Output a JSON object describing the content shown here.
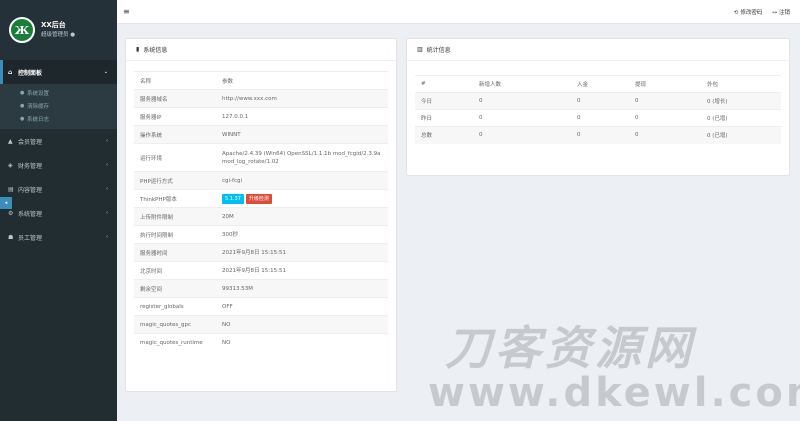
{
  "app": {
    "title": "XX后台",
    "subtitle": "超级管理员 ●",
    "logo_text": "Ж"
  },
  "sidebar": {
    "items": [
      {
        "label": "控制面板",
        "icon": "home-icon",
        "active": true
      },
      {
        "label": "会员管理",
        "icon": "user-icon"
      },
      {
        "label": "财务管理",
        "icon": "money-icon"
      },
      {
        "label": "内容管理",
        "icon": "file-icon"
      },
      {
        "label": "系统管理",
        "icon": "gear-icon"
      },
      {
        "label": "员工管理",
        "icon": "users-icon"
      }
    ],
    "submenu": [
      "系统设置",
      "清除缓存",
      "系统日志"
    ],
    "side_tab_label": "◂"
  },
  "topbar": {
    "menu_icon": "≡",
    "links": [
      {
        "label": "修改密码",
        "icon": "key-icon"
      },
      {
        "label": "注销",
        "icon": "logout-icon"
      }
    ]
  },
  "system_panel": {
    "title": "系统信息",
    "headers": [
      "名称",
      "参数"
    ],
    "rows": [
      [
        "服务器域名",
        "http://www.xxx.com"
      ],
      [
        "服务器IP",
        "127.0.0.1"
      ],
      [
        "操作系统",
        "WINNT"
      ],
      [
        "运行环境",
        "Apache/2.4.39 (Win64) OpenSSL/1.1.1b mod_fcgid/2.3.9a mod_log_rotate/1.02"
      ],
      [
        "PHP运行方式",
        "cgi-fcgi"
      ],
      [
        "ThinkPHP版本",
        ""
      ],
      [
        "上传附件限制",
        "20M"
      ],
      [
        "执行时间限制",
        "300秒"
      ],
      [
        "服务器时间",
        "2021年9月8日 15:15:51"
      ],
      [
        "北京时间",
        "2021年9月8日 15:15:51"
      ],
      [
        "剩余空间",
        "99313.53M"
      ],
      [
        "register_globals",
        "OFF"
      ],
      [
        "magic_quotes_gpc",
        "NO"
      ],
      [
        "magic_quotes_runtime",
        "NO"
      ]
    ],
    "badges": [
      {
        "label": "5.1.37",
        "color": "#00c0ef"
      },
      {
        "label": "升级检测",
        "color": "#dd4b39"
      }
    ]
  },
  "stats_panel": {
    "title": "统计信息",
    "headers": [
      "#",
      "新增人数",
      "入金",
      "提现",
      "外包"
    ],
    "rows": [
      [
        "今日",
        "0",
        "0",
        "0",
        "0 (增长)"
      ],
      [
        "昨日",
        "0",
        "0",
        "0",
        "0 (已增)"
      ],
      [
        "总数",
        "0",
        "0",
        "0",
        "0 (已增)"
      ]
    ]
  },
  "watermark": {
    "line1": "刀客资源网",
    "line2": "www.dkewl.com"
  }
}
